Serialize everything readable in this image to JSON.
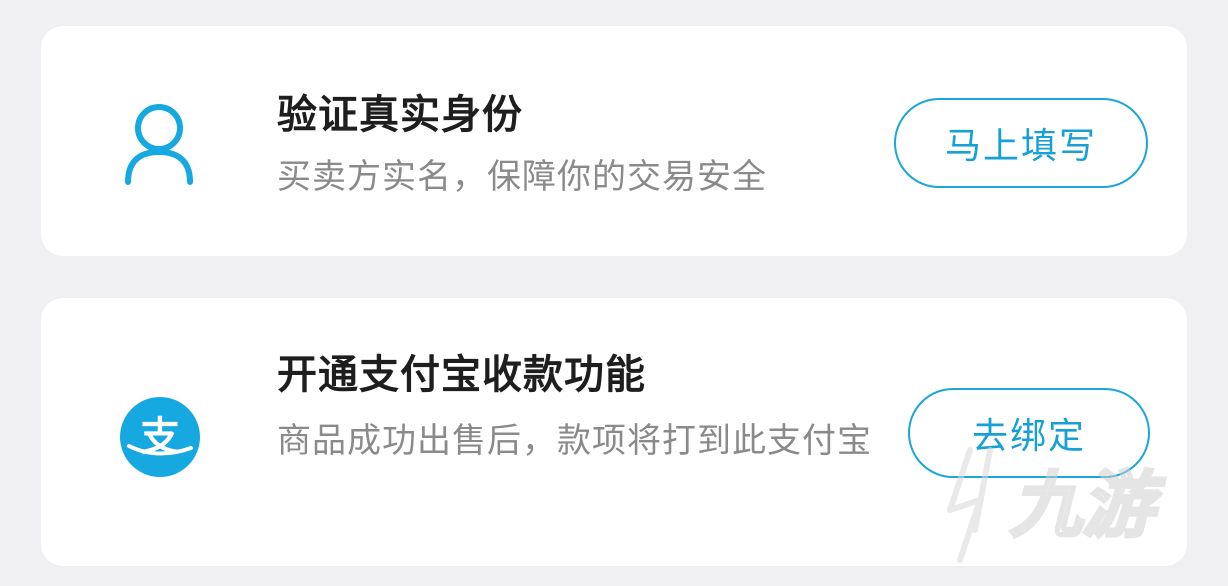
{
  "cards": [
    {
      "title": "验证真实身份",
      "description": "买卖方实名，保障你的交易安全",
      "button_label": "马上填写",
      "icon": "user-icon"
    },
    {
      "title": "开通支付宝收款功能",
      "description": "商品成功出售后，款项将打到此支付宝",
      "button_label": "去绑定",
      "icon": "alipay-icon",
      "icon_glyph": "支"
    }
  ],
  "watermark_text": "九游",
  "colors": {
    "accent": "#16a0d6",
    "background": "#f0f0f3",
    "card": "#ffffff",
    "title": "#1e1e1e",
    "description": "#8a8a8a"
  }
}
